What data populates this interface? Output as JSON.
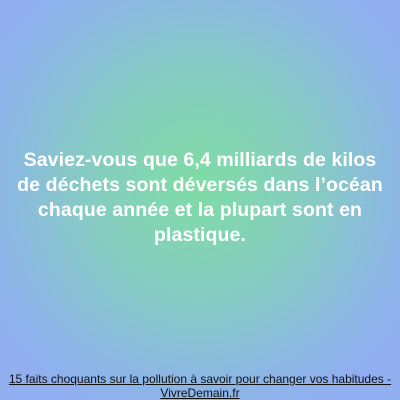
{
  "fact": {
    "text": "Saviez-vous que 6,4 milliards de kilos de déchets sont déversés dans l’océan chaque année et la plupart sont en plastique."
  },
  "caption": {
    "link_text": "15 faits choquants sur la pollution à savoir pour changer vos habitudes - VivreDemain.fr"
  },
  "colors": {
    "center": "#7fdca4",
    "edge": "#90aef0",
    "text": "#ffffff",
    "caption_text": "#111111"
  }
}
